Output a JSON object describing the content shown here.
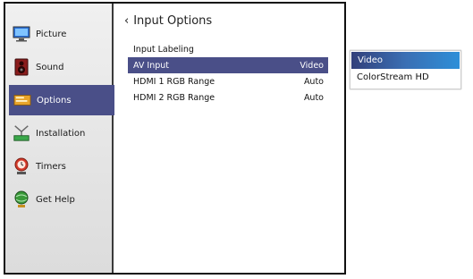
{
  "sidebar": {
    "items": [
      {
        "label": "Picture",
        "icon": "picture-icon"
      },
      {
        "label": "Sound",
        "icon": "speaker-icon"
      },
      {
        "label": "Options",
        "icon": "options-icon",
        "active": true
      },
      {
        "label": "Installation",
        "icon": "antenna-icon"
      },
      {
        "label": "Timers",
        "icon": "clock-icon"
      },
      {
        "label": "Get Help",
        "icon": "help-globe-icon"
      }
    ]
  },
  "content": {
    "title": "Input Options",
    "rows": [
      {
        "label": "Input Labeling",
        "value": ""
      },
      {
        "label": "AV Input",
        "value": "Video",
        "selected": true
      },
      {
        "label": "HDMI 1 RGB Range",
        "value": "Auto"
      },
      {
        "label": "HDMI 2 RGB Range",
        "value": "Auto"
      }
    ]
  },
  "popup": {
    "options": [
      "Video",
      "ColorStream HD"
    ],
    "selected": "Video"
  },
  "colors": {
    "highlight": "#4a4f88",
    "popup_highlight": "#3a6fb4",
    "sidebar_bg": "#e6e6e6"
  }
}
